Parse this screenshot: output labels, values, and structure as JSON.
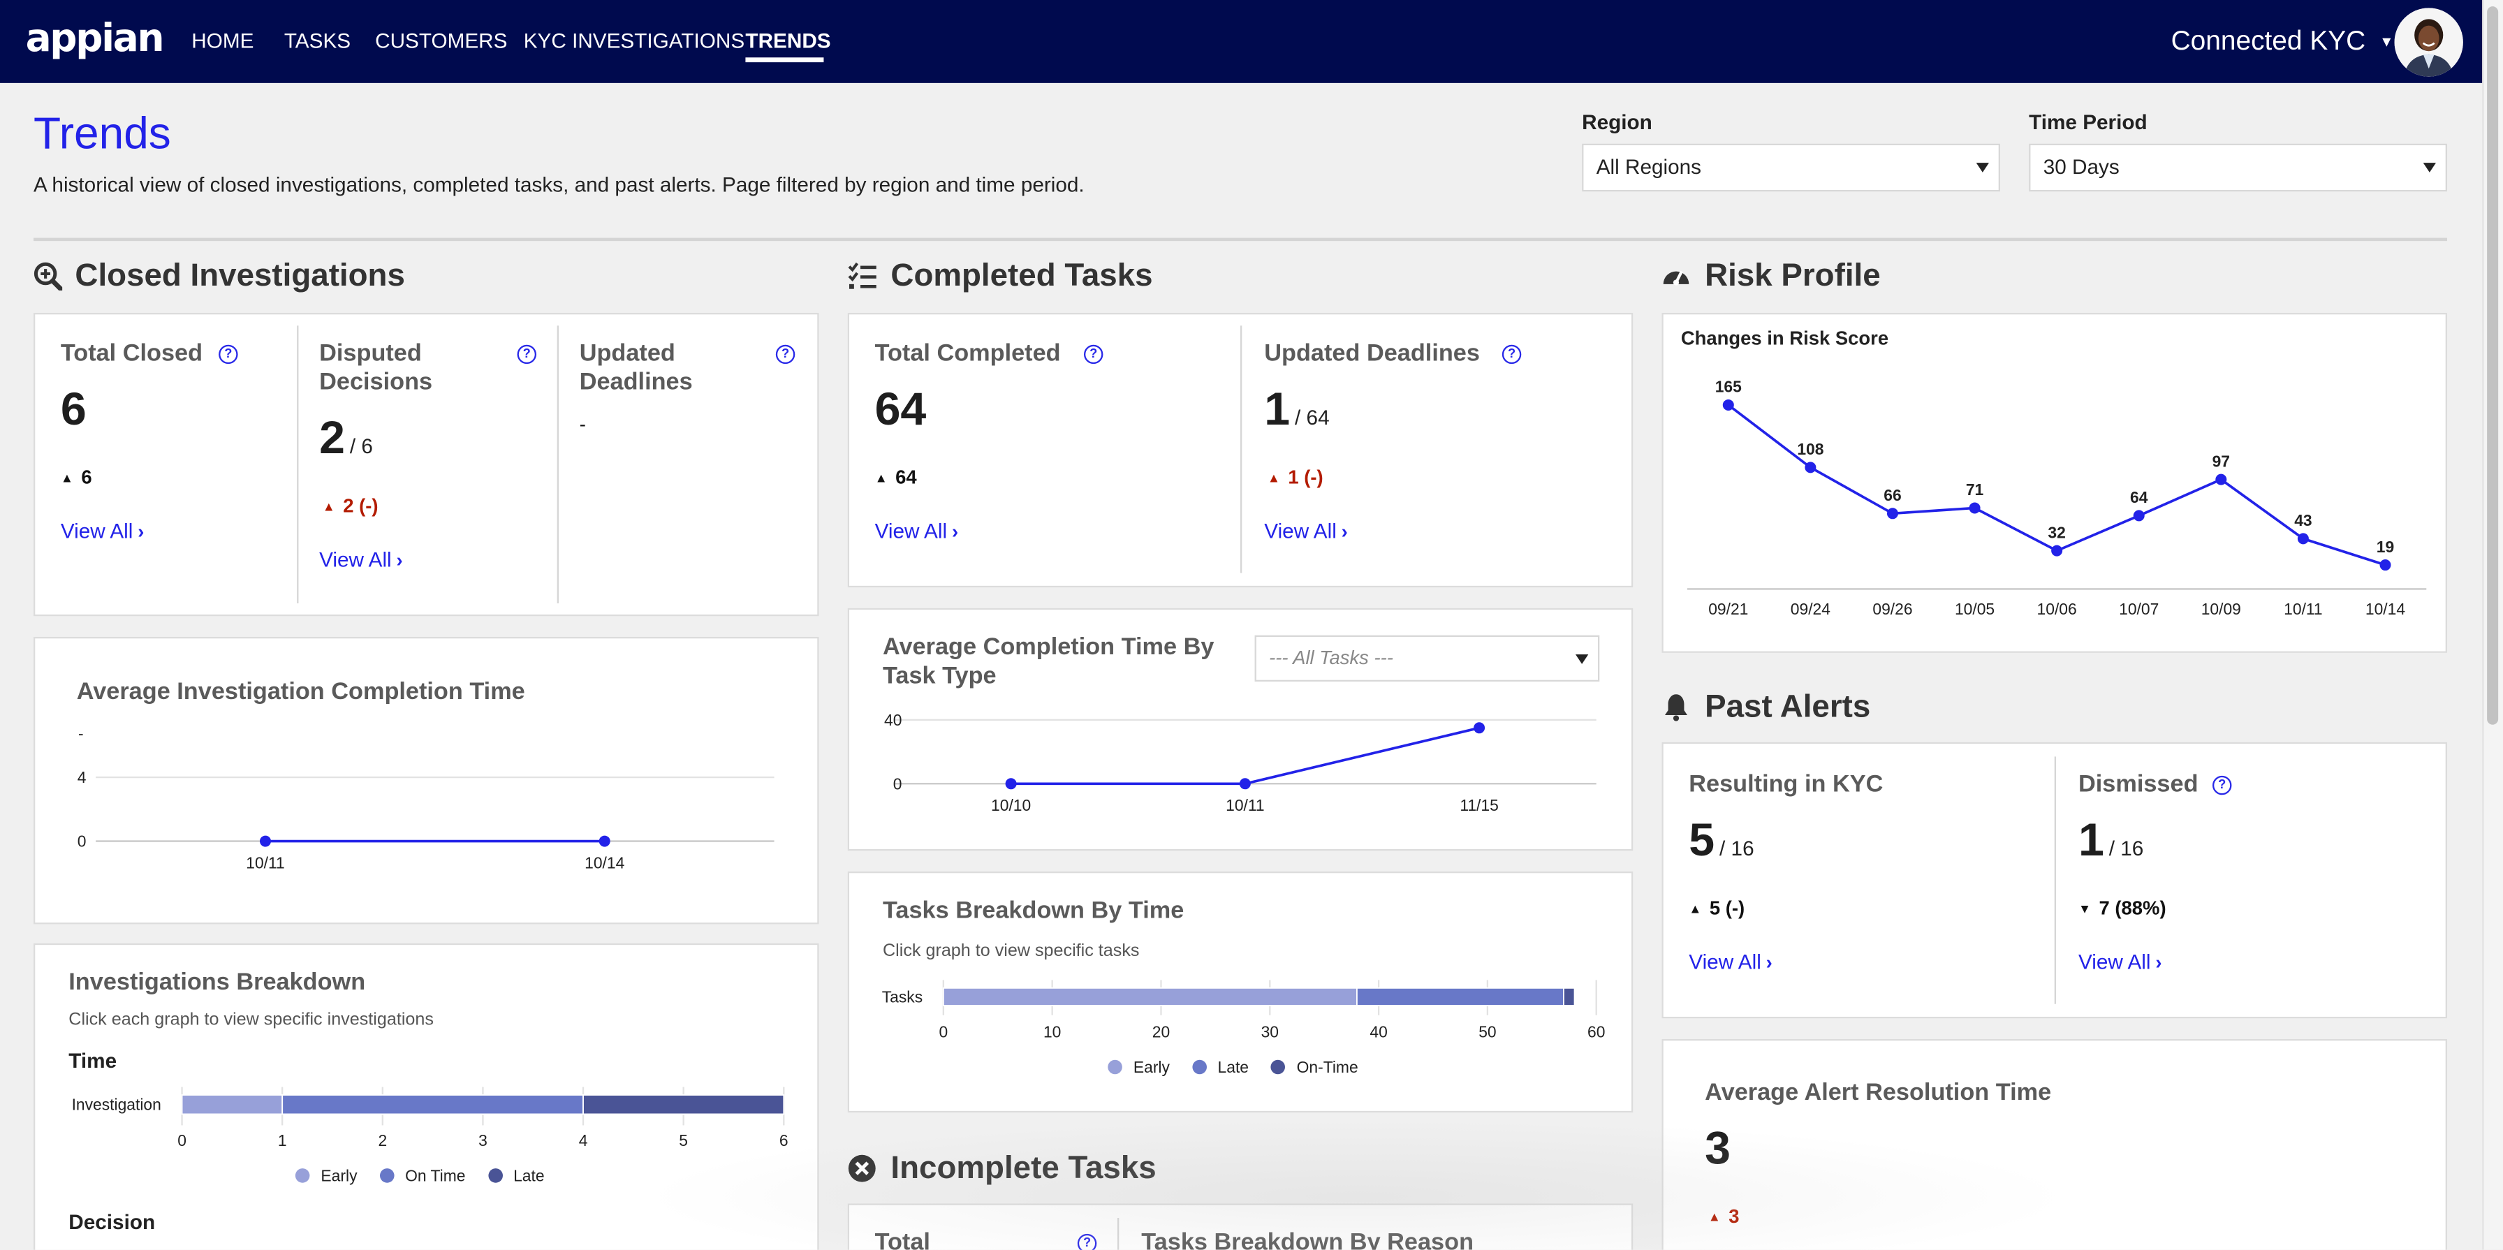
{
  "nav": {
    "logo": "appian",
    "items": [
      {
        "label": "HOME"
      },
      {
        "label": "TASKS"
      },
      {
        "label": "CUSTOMERS"
      },
      {
        "label": "KYC INVESTIGATIONS"
      },
      {
        "label": "TRENDS",
        "active": true
      }
    ],
    "user_menu": "Connected KYC"
  },
  "page": {
    "title": "Trends",
    "description": "A historical view of closed investigations, completed tasks, and past alerts. Page filtered by region and time period."
  },
  "filters": {
    "region": {
      "label": "Region",
      "value": "All Regions"
    },
    "time_period": {
      "label": "Time Period",
      "value": "30 Days"
    }
  },
  "closed_investigations": {
    "heading": "Closed Investigations",
    "metrics": [
      {
        "label": "Total Closed",
        "value": "6",
        "delta": "6",
        "delta_direction": "up",
        "link": "View All"
      },
      {
        "label": "Disputed Decisions",
        "value": "2",
        "total": "/ 6",
        "delta": "2 (-)",
        "delta_direction": "up",
        "delta_color": "#b31b00",
        "link": "View All"
      },
      {
        "label": "Updated Deadlines",
        "value": "-"
      }
    ],
    "avg_completion": {
      "title": "Average Investigation Completion Time"
    },
    "breakdown": {
      "title": "Investigations Breakdown",
      "subtitle": "Click each graph to view specific investigations",
      "time_label": "Time",
      "decision_label": "Decision"
    }
  },
  "completed_tasks": {
    "heading": "Completed Tasks",
    "metrics": [
      {
        "label": "Total Completed",
        "value": "64",
        "delta": "64",
        "delta_direction": "up",
        "link": "View All"
      },
      {
        "label": "Updated Deadlines",
        "value": "1",
        "total": "/ 64",
        "delta": "1 (-)",
        "delta_direction": "up",
        "delta_color": "#b31b00",
        "link": "View All"
      }
    ],
    "avg_by_type": {
      "title": "Average Completion Time By Task Type",
      "filter_placeholder": "--- All Tasks ---"
    },
    "breakdown": {
      "title": "Tasks Breakdown By Time",
      "subtitle": "Click graph to view specific tasks"
    }
  },
  "incomplete_tasks": {
    "heading": "Incomplete Tasks",
    "total_label": "Total",
    "breakdown_label": "Tasks Breakdown By Reason"
  },
  "risk_profile": {
    "heading": "Risk Profile",
    "chart_title": "Changes in Risk Score"
  },
  "past_alerts": {
    "heading": "Past Alerts",
    "metrics": [
      {
        "label": "Resulting in KYC",
        "value": "5",
        "total": "/ 16",
        "delta": "5 (-)",
        "delta_direction": "up",
        "link": "View All"
      },
      {
        "label": "Dismissed",
        "value": "1",
        "total": "/ 16",
        "delta": "7 (88%)",
        "delta_direction": "down",
        "link": "View All"
      }
    ],
    "avg_resolution": {
      "title": "Average Alert Resolution Time",
      "value": "3",
      "delta": "3",
      "delta_direction": "up",
      "delta_color": "#b31b00"
    }
  },
  "colors": {
    "nav_bg": "#000a4e",
    "accent_blue": "#2222e8",
    "negative_red": "#b31b00",
    "early": "#97a0d9",
    "on_time_investigation": "#6878c8",
    "late_investigation": "#4a5496",
    "late_task": "#6878c8",
    "on_time_task": "#4a5496"
  },
  "chart_data": [
    {
      "id": "avg-investigation",
      "type": "line",
      "categories": [
        "10/11",
        "10/14"
      ],
      "values": [
        0,
        0
      ],
      "y_ticks": [
        "0",
        "4"
      ],
      "y_top_label": "-",
      "ylim": [
        0,
        4
      ],
      "grid": true,
      "color": "#2222e8"
    },
    {
      "id": "avg-task-type",
      "type": "line",
      "categories": [
        "10/10",
        "10/11",
        "11/15"
      ],
      "values": [
        0,
        0,
        35
      ],
      "y_ticks": [
        "0",
        "40"
      ],
      "ylim": [
        0,
        40
      ],
      "grid": true,
      "color": "#2222e8"
    },
    {
      "id": "risk-score",
      "type": "line",
      "title": "Changes in Risk Score",
      "categories": [
        "09/21",
        "09/24",
        "09/26",
        "10/05",
        "10/06",
        "10/07",
        "10/09",
        "10/11",
        "10/14"
      ],
      "values": [
        165,
        108,
        66,
        71,
        32,
        64,
        97,
        43,
        19
      ],
      "data_labels": true,
      "ylim": [
        0,
        185
      ],
      "grid": false,
      "color": "#2222e8"
    },
    {
      "id": "investigations-time",
      "type": "bar",
      "orientation": "horizontal-stacked",
      "categories": [
        "Investigation"
      ],
      "series": [
        {
          "name": "Early",
          "values": [
            1
          ],
          "color": "#97a0d9"
        },
        {
          "name": "On Time",
          "values": [
            3
          ],
          "color": "#6878c8"
        },
        {
          "name": "Late",
          "values": [
            2
          ],
          "color": "#4a5496"
        }
      ],
      "x_ticks": [
        "0",
        "1",
        "2",
        "3",
        "4",
        "5",
        "6"
      ],
      "xlim": [
        0,
        6
      ],
      "legend": "bottom"
    },
    {
      "id": "tasks-time",
      "type": "bar",
      "orientation": "horizontal-stacked",
      "categories": [
        "Tasks"
      ],
      "series": [
        {
          "name": "Early",
          "values": [
            38
          ],
          "color": "#97a0d9"
        },
        {
          "name": "Late",
          "values": [
            19
          ],
          "color": "#6878c8"
        },
        {
          "name": "On-Time",
          "values": [
            1
          ],
          "color": "#4a5496"
        }
      ],
      "x_ticks": [
        "0",
        "10",
        "20",
        "30",
        "40",
        "50",
        "60"
      ],
      "xlim": [
        0,
        60
      ],
      "legend": "bottom"
    }
  ]
}
